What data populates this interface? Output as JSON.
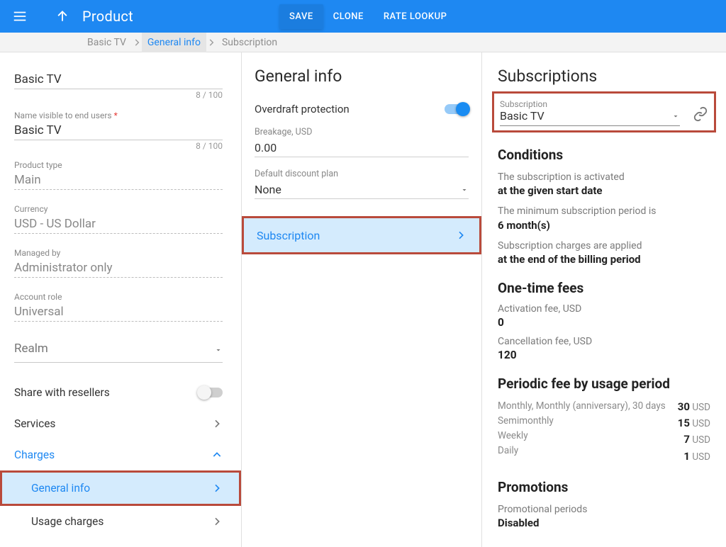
{
  "topbar": {
    "title": "Product",
    "save": "SAVE",
    "clone": "CLONE",
    "rate_lookup": "RATE LOOKUP"
  },
  "breadcrumbs": [
    "Basic TV",
    "General info",
    "Subscription"
  ],
  "panel1": {
    "name": {
      "value": "Basic TV",
      "counter": "8 / 100"
    },
    "name_user": {
      "label": "Name visible to end users",
      "value": "Basic TV",
      "counter": "8 / 100"
    },
    "product_type": {
      "label": "Product type",
      "value": "Main"
    },
    "currency": {
      "label": "Currency",
      "value": "USD - US Dollar"
    },
    "managed_by": {
      "label": "Managed by",
      "value": "Administrator only"
    },
    "account_role": {
      "label": "Account role",
      "value": "Universal"
    },
    "realm": {
      "label": "Realm"
    },
    "share": {
      "label": "Share with resellers"
    },
    "nav": {
      "services": "Services",
      "charges": "Charges",
      "general_info": "General info",
      "usage_charges": "Usage charges"
    }
  },
  "panel2": {
    "title": "General info",
    "overdraft": "Overdraft protection",
    "breakage": {
      "label": "Breakage, USD",
      "value": "0.00"
    },
    "discount": {
      "label": "Default discount plan",
      "value": "None"
    },
    "subscription": "Subscription"
  },
  "panel3": {
    "title": "Subscriptions",
    "sub": {
      "label": "Subscription",
      "value": "Basic TV"
    },
    "conditions": {
      "heading": "Conditions",
      "l1": "The subscription is activated",
      "v1": "at the given start date",
      "l2": "The minimum subscription period is",
      "v2": "6 month(s)",
      "l3": "Subscription charges are applied",
      "v3": "at the end of the billing period"
    },
    "onetime": {
      "heading": "One-time fees",
      "act_l": "Activation fee, USD",
      "act_v": "0",
      "can_l": "Cancellation fee, USD",
      "can_v": "120"
    },
    "periodic": {
      "heading": "Periodic fee by usage period",
      "rows": [
        {
          "label": "Monthly, Monthly (anniversary), 30 days",
          "amount": "30",
          "unit": "USD"
        },
        {
          "label": "Semimonthly",
          "amount": "15",
          "unit": "USD"
        },
        {
          "label": "Weekly",
          "amount": "7",
          "unit": "USD"
        },
        {
          "label": "Daily",
          "amount": "1",
          "unit": "USD"
        }
      ]
    },
    "promo": {
      "heading": "Promotions",
      "label": "Promotional periods",
      "value": "Disabled"
    }
  }
}
